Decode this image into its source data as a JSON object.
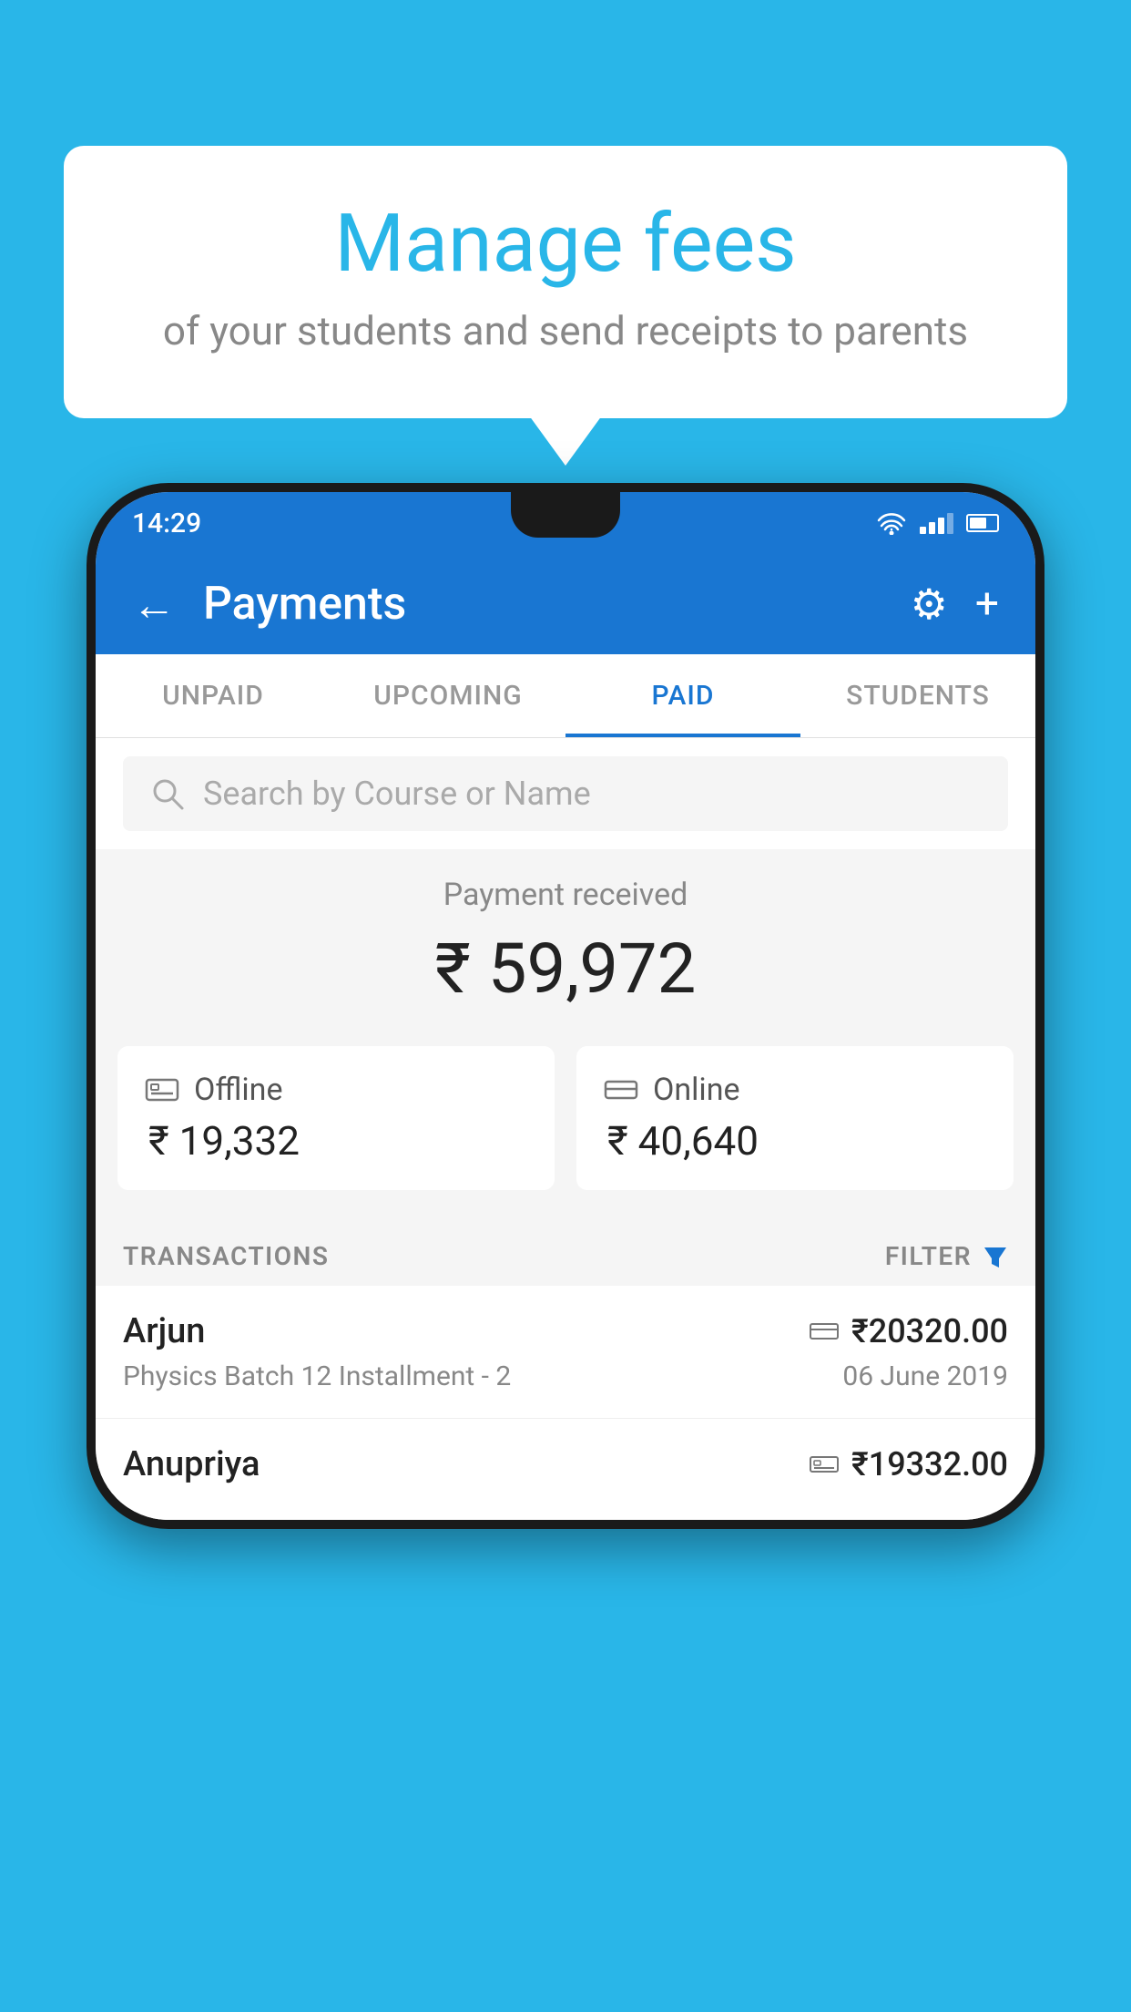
{
  "background_color": "#29b6e8",
  "bubble": {
    "title": "Manage fees",
    "subtitle": "of your students and send receipts to parents"
  },
  "status_bar": {
    "time": "14:29",
    "wifi": "wifi",
    "signal": "signal",
    "battery": "battery"
  },
  "header": {
    "title": "Payments",
    "back_label": "←",
    "settings_icon": "⚙",
    "add_icon": "+"
  },
  "tabs": [
    {
      "label": "UNPAID",
      "active": false
    },
    {
      "label": "UPCOMING",
      "active": false
    },
    {
      "label": "PAID",
      "active": true
    },
    {
      "label": "STUDENTS",
      "active": false
    }
  ],
  "search": {
    "placeholder": "Search by Course or Name"
  },
  "payment_summary": {
    "label": "Payment received",
    "amount": "₹ 59,972"
  },
  "payment_cards": [
    {
      "icon": "offline",
      "label": "Offline",
      "amount": "₹ 19,332"
    },
    {
      "icon": "online",
      "label": "Online",
      "amount": "₹ 40,640"
    }
  ],
  "transactions": {
    "label": "TRANSACTIONS",
    "filter_label": "FILTER",
    "rows": [
      {
        "name": "Arjun",
        "description": "Physics Batch 12 Installment - 2",
        "amount": "₹20320.00",
        "date": "06 June 2019",
        "pay_type": "online"
      },
      {
        "name": "Anupriya",
        "description": "",
        "amount": "₹19332.00",
        "date": "",
        "pay_type": "offline"
      }
    ]
  }
}
